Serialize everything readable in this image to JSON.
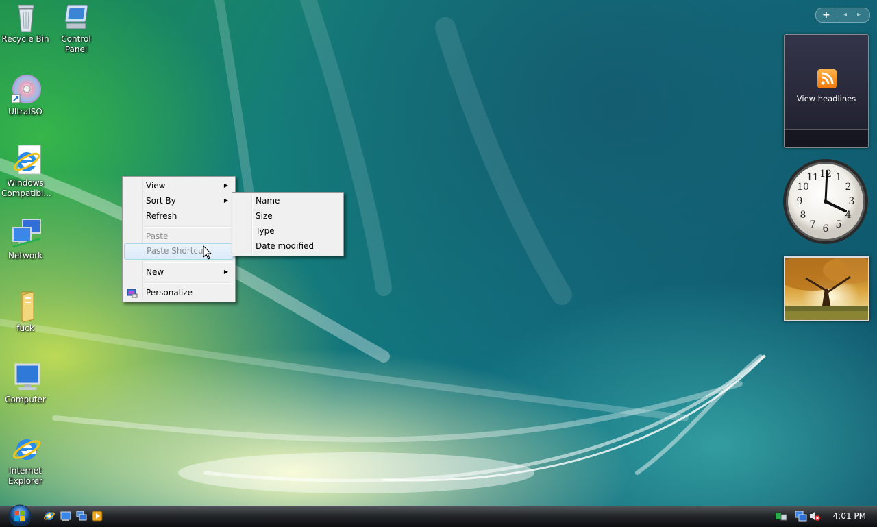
{
  "desktop": {
    "icons": [
      {
        "name": "Recycle Bin"
      },
      {
        "name": "Control Panel"
      },
      {
        "name": "UltraISO"
      },
      {
        "name": "Windows Compatibi..."
      },
      {
        "name": "Network"
      },
      {
        "name": "fuck"
      },
      {
        "name": "Computer"
      },
      {
        "name": "Internet Explorer"
      }
    ]
  },
  "context_menu": {
    "items": [
      {
        "label": "View"
      },
      {
        "label": "Sort By"
      },
      {
        "label": "Refresh"
      },
      {
        "label": "Paste"
      },
      {
        "label": "Paste Shortcut"
      },
      {
        "label": "New"
      },
      {
        "label": "Personalize"
      }
    ]
  },
  "sort_submenu": {
    "items": [
      {
        "label": "Name"
      },
      {
        "label": "Size"
      },
      {
        "label": "Type"
      },
      {
        "label": "Date modified"
      }
    ]
  },
  "sidebar": {
    "controls": {
      "add": "+",
      "prev": "◂",
      "next": "▸"
    },
    "feed": {
      "label": "View headlines"
    },
    "clock": {
      "numbers": [
        "12",
        "1",
        "2",
        "3",
        "4",
        "5",
        "6",
        "7",
        "8",
        "9",
        "10",
        "11"
      ]
    }
  },
  "taskbar": {
    "clock_time": "4:01 PM"
  },
  "colors": {
    "menu_bg": "#f0f0f0",
    "menu_hover": "#dcebfa",
    "feed_orange": "#f07a0a"
  }
}
